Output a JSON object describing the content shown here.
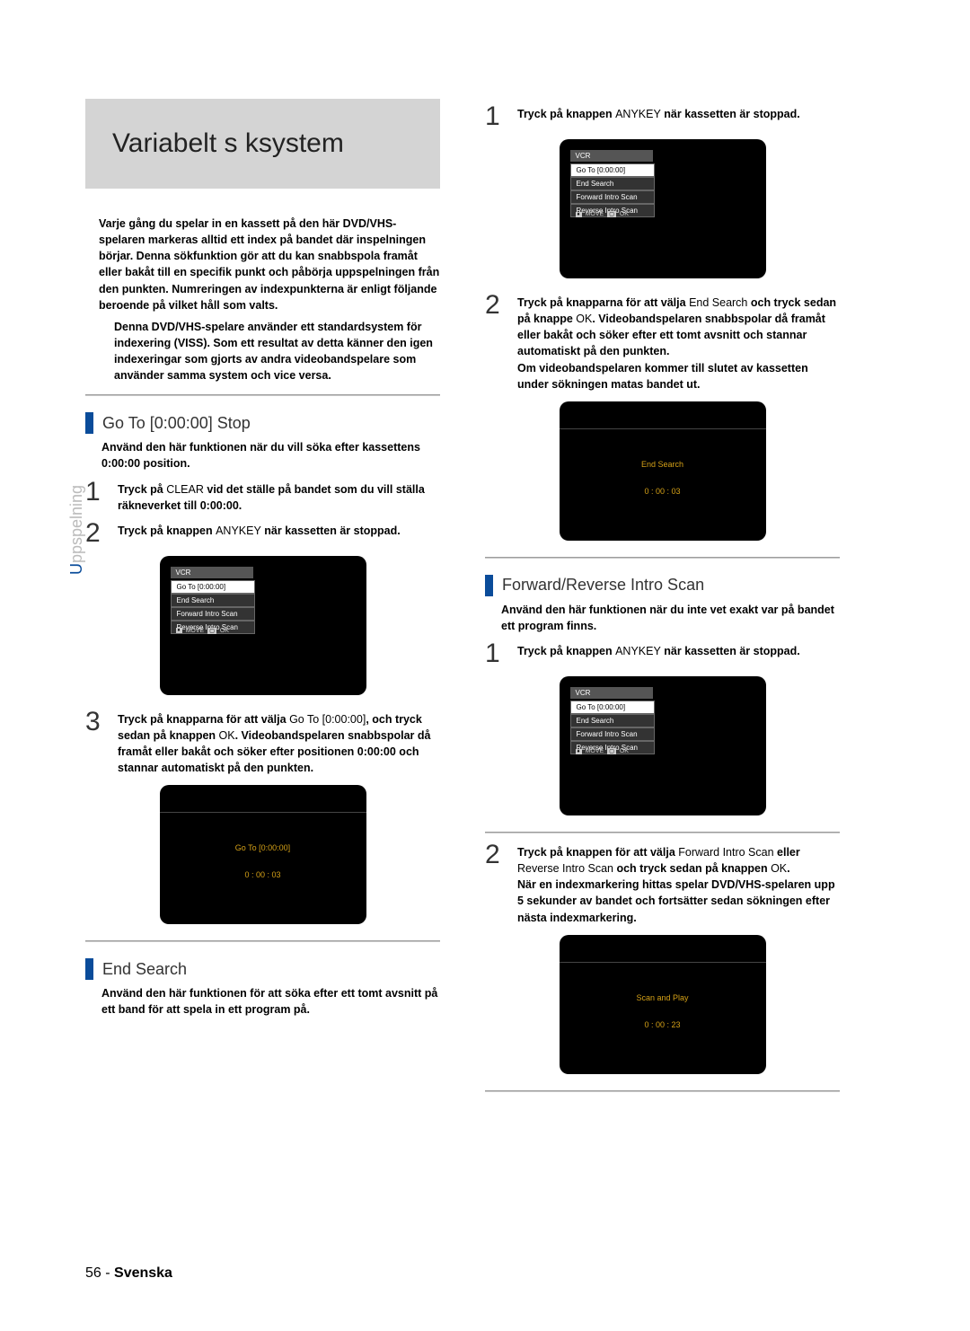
{
  "title": "Variabelt s ksystem",
  "side_label_cap": "U",
  "side_label_rest": "ppspelning",
  "page_num": "56 - ",
  "page_lang": "Svenska",
  "intro1": "Varje gång du spelar in en kassett på den här DVD/VHS-spelaren markeras alltid ett index på bandet där inspelningen börjar. Denna sökfunktion gör att du kan snabbspola framåt eller bakåt till en specifik punkt och påbörja uppspelningen från den punkten. Numreringen av indexpunkterna är enligt följande beroende på vilket håll som valts.",
  "intro2": "Denna DVD/VHS-spelare använder ett standardsystem för indexering (VISS). Som ett resultat av detta känner den igen indexeringar som gjorts av andra videobandspelare som använder samma system och vice versa.",
  "sec_goto": "Go To [0:00:00] Stop",
  "goto_sub": "Använd den här funktionen när du vill söka efter kassettens 0:00:00 position.",
  "goto_s1a": "Tryck på ",
  "goto_s1b": "CLEAR",
  "goto_s1c": " vid det ställe på bandet som du vill ställa räkneverket till 0:00:00.",
  "goto_s2a": "Tryck på knappen ",
  "goto_s2b": "ANYKEY",
  "goto_s2c": " när kassetten är stoppad.",
  "goto_s3a": "Tryck på knapparna ",
  "goto_s3b": "för att välja ",
  "goto_s3c": "Go To [0:00:00]",
  "goto_s3d": ", och tryck sedan på knappen ",
  "goto_s3e": "OK",
  "goto_s3f": ". Videobandspelaren snabbspolar då framåt eller bakåt och söker efter positionen 0:00:00 och stannar automatiskt på den punkten.",
  "sec_end": "End Search",
  "end_sub": "Använd den här funktionen för att söka efter ett tomt avsnitt på ett band för att spela in ett program på.",
  "end_s1a": "Tryck på knappen ",
  "end_s1b": "ANYKEY",
  "end_s1c": " när kassetten är stoppad.",
  "end_s2a": "Tryck på knapparna ",
  "end_s2b": "för att välja ",
  "end_s2c": "End Search",
  "end_s2d": " och tryck sedan på knappe ",
  "end_s2e": "OK",
  "end_s2f": ". Videobandspelaren snabbspolar då framåt eller bakåt och söker efter ett tomt avsnitt och stannar automatiskt på den punkten.",
  "end_s2g": "Om videobandspelaren kommer till slutet av kassetten under sökningen matas bandet ut.",
  "sec_fwd": "Forward/Reverse Intro Scan",
  "fwd_sub": "Använd den här funktionen när du inte vet exakt var på bandet ett program finns.",
  "fwd_s1a": "Tryck på knappen ",
  "fwd_s1b": "ANYKEY",
  "fwd_s1c": " när kassetten är stoppad.",
  "fwd_s2a": "Tryck på knappen ",
  "fwd_s2b": "för att välja ",
  "fwd_s2c": "Forward Intro Scan",
  "fwd_s2d": " eller ",
  "fwd_s2e": "Reverse Intro Scan",
  "fwd_s2f": " och tryck sedan på knappen ",
  "fwd_s2g": "OK",
  "fwd_s2h": ".",
  "fwd_s2i": "När en indexmarkering hittas spelar DVD/VHS-spelaren upp 5 sekunder av bandet och fortsätter sedan sökningen efter nästa indexmarkering.",
  "vcr_menu": {
    "title": "VCR",
    "items": [
      "Go To [0:00:00]",
      "End Search",
      "Forward Intro Scan",
      "Reverse Intro Scan"
    ],
    "move": "MOVE",
    "ok": "OK"
  },
  "screen_goto": {
    "l1": "Go To [0:00:00]",
    "l2": "0 : 00 : 03"
  },
  "screen_end": {
    "l1": "End Search",
    "l2": "0 : 00 : 03"
  },
  "screen_scan": {
    "l1": "Scan and Play",
    "l2": "0 : 00 : 23"
  }
}
